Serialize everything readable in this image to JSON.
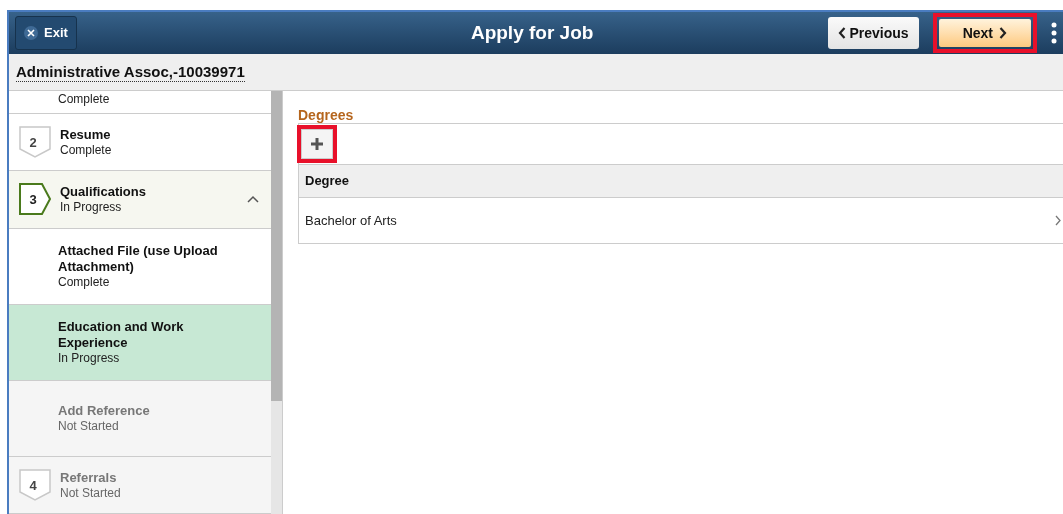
{
  "header": {
    "exit": "Exit",
    "title": "Apply for Job",
    "previous": "Previous",
    "next": "Next"
  },
  "job_title": "Administrative Assoc,-10039971",
  "sidebar": {
    "items": [
      {
        "kind": "cut",
        "status": "Complete",
        "selected": false,
        "disabled": false
      },
      {
        "kind": "step",
        "number": "2",
        "title": "Resume",
        "status": "Complete",
        "selected": false,
        "disabled": false,
        "current": false
      },
      {
        "kind": "step",
        "number": "3",
        "title": "Qualifications",
        "status": "In Progress",
        "selected": false,
        "disabled": false,
        "current": true,
        "expanded": true
      },
      {
        "kind": "substep",
        "title": "Attached File (use Upload Attachment)",
        "status": "Complete",
        "selected": false,
        "disabled": false
      },
      {
        "kind": "substep",
        "title": "Education and Work Experience",
        "status": "In Progress",
        "selected": true,
        "disabled": false
      },
      {
        "kind": "substep",
        "title": "Add Reference",
        "status": "Not Started",
        "selected": false,
        "disabled": true
      },
      {
        "kind": "step",
        "number": "4",
        "title": "Referrals",
        "status": "Not Started",
        "selected": false,
        "disabled": true,
        "current": false
      }
    ]
  },
  "section": {
    "title": "Degrees",
    "table": {
      "columns": [
        "Degree"
      ],
      "rows": [
        [
          "Bachelor of Arts"
        ]
      ]
    }
  }
}
